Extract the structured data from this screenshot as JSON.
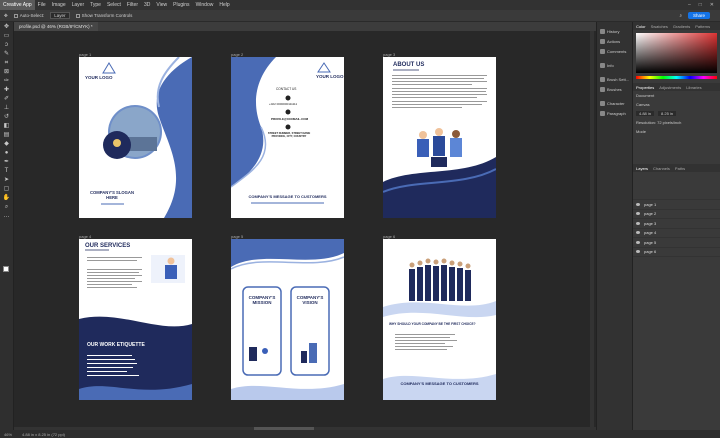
{
  "menu": {
    "app_button": "Creative App",
    "items": [
      "File",
      "Image",
      "Layer",
      "Type",
      "Select",
      "Filter",
      "3D",
      "View",
      "Plugins",
      "Window",
      "Help"
    ]
  },
  "options": {
    "auto_select": "Auto-Select:",
    "auto_select_value": "Layer",
    "transform": "Show Transform Controls",
    "share": "Share"
  },
  "document_tab": "profile.psd @ 46% (RGB/8*/CMYK) *",
  "status": {
    "zoom": "46%",
    "doc_info": "4.88 in x 8.25 in (72 ppi)"
  },
  "pages": [
    {
      "label": "page 1",
      "logo": "YOUR LOGO",
      "slogan": "COMPANY'S SLOGAN HERE"
    },
    {
      "label": "page 2",
      "logo": "YOUR LOGO",
      "contact": "CONTACT US",
      "phone": "+022 0000000111111",
      "email": "PROFILE@XXXMAIL.COM",
      "address": "STREET NUMBER, STREET NAME PROVINCE, CITY, COUNTRY",
      "message": "COMPANY'S MESSAGE TO CUSTOMERS"
    },
    {
      "label": "page 3",
      "title": "ABOUT US"
    },
    {
      "label": "page 4",
      "services": "OUR SERVICES",
      "etiquette": "OUR WORK ETIQUETTE"
    },
    {
      "label": "page 5",
      "mission": "COMPANY'S MISSION",
      "vision": "COMPANY'S VISION"
    },
    {
      "label": "page 6",
      "question": "WHY SHOULD YOUR COMPANY BE THE FIRST CHOICE?",
      "message": "COMPANY'S MESSAGE TO CUSTOMERS"
    }
  ],
  "panel_icons": [
    "History",
    "Actions",
    "Comments",
    "Info",
    "Brush Sett...",
    "Brushes",
    "Character",
    "Paragraph"
  ],
  "color_tabs": [
    "Color",
    "Swatches",
    "Gradients",
    "Patterns"
  ],
  "properties_tabs": [
    "Properties",
    "Adjustments",
    "Libraries"
  ],
  "properties": {
    "doc": "Document",
    "canvas": "Canvas",
    "w": "4.88 in",
    "h": "8.25 in",
    "resolution": "Resolution: 72 pixels/inch",
    "mode": "Mode"
  },
  "layers_tabs": [
    "Layers",
    "Channels",
    "Paths"
  ],
  "layers": [
    "page 1",
    "page 2",
    "page 3",
    "page 4",
    "page 5",
    "page 6"
  ],
  "colors": {
    "accent": "#4a6bb5",
    "navy": "#1f2a5c"
  }
}
